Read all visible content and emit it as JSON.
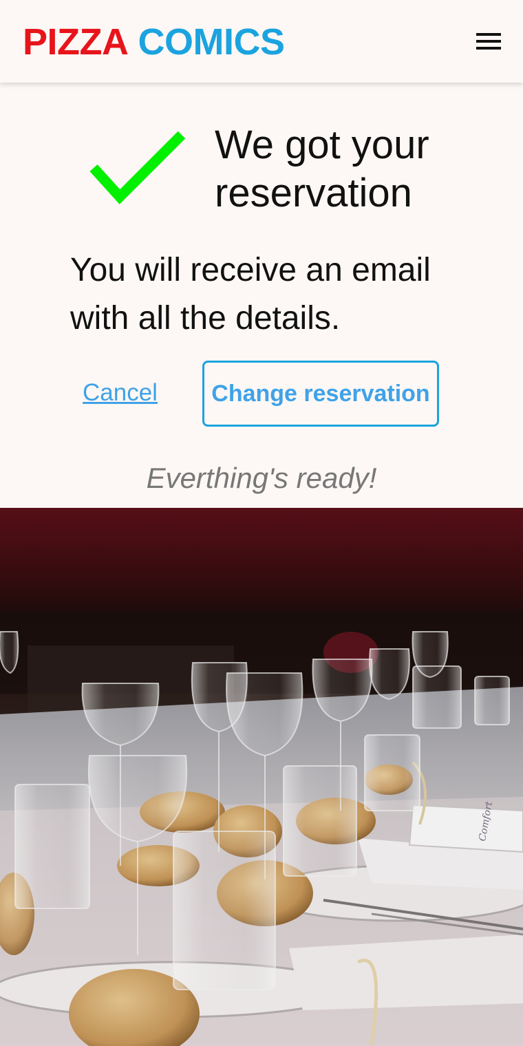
{
  "header": {
    "brand_part1": "PIZZA",
    "brand_part2": "COMICS",
    "brand_color1": "#e8141b",
    "brand_color2": "#1ba3df",
    "menu_icon": "hamburger-menu-icon"
  },
  "confirmation": {
    "icon": "checkmark-icon",
    "icon_color": "#00f000",
    "title": "We got your reservation",
    "message": "You will receive an email with all the details."
  },
  "actions": {
    "cancel_label": "Cancel",
    "change_label": "Change reservation",
    "accent_color": "#1ba3df"
  },
  "tagline": "Everthing's ready!",
  "photo": {
    "subject": "restaurant-table-setting",
    "card_script": "Comfort"
  }
}
